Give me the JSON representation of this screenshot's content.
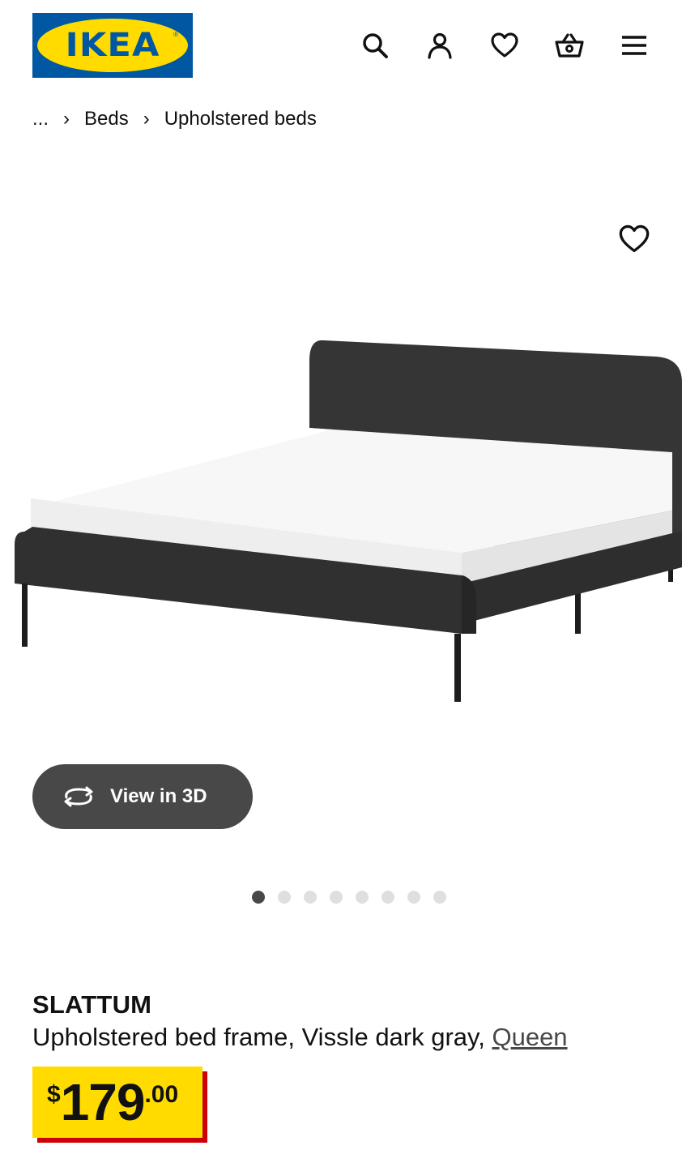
{
  "header": {
    "logo_text": "IKEA",
    "logo_reg": "®",
    "icons": [
      "search-icon",
      "account-icon",
      "favorites-icon",
      "cart-icon",
      "menu-icon"
    ]
  },
  "breadcrumb": {
    "ellipsis": "...",
    "separator": "›",
    "items": [
      "Beds",
      "Upholstered beds"
    ]
  },
  "gallery": {
    "view3d_label": "View in 3D",
    "dots_total": 8,
    "active_dot": 1
  },
  "product": {
    "name": "SLATTUM",
    "description": "Upholstered bed frame, Vissle dark gray, ",
    "size_link": "Queen",
    "price": {
      "currency": "$",
      "integer": "179",
      "decimal": ".00"
    }
  },
  "colors": {
    "ikea_blue": "#0058a3",
    "ikea_yellow": "#ffdb00",
    "price_shadow": "#cc0008",
    "button_dark": "#484848"
  }
}
